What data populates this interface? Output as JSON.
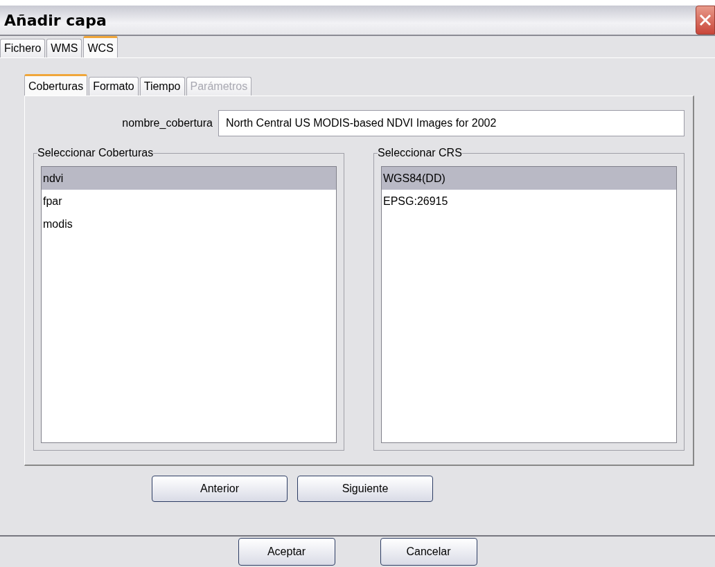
{
  "window": {
    "title": "Añadir capa"
  },
  "tabs": [
    {
      "label": "Fichero",
      "selected": false
    },
    {
      "label": "WMS",
      "selected": false
    },
    {
      "label": "WCS",
      "selected": true
    }
  ],
  "subtabs": [
    {
      "label": "Coberturas",
      "selected": true,
      "disabled": false
    },
    {
      "label": "Formato",
      "selected": false,
      "disabled": false
    },
    {
      "label": "Tiempo",
      "selected": false,
      "disabled": false
    },
    {
      "label": "Parámetros",
      "selected": false,
      "disabled": true
    }
  ],
  "coverage_name": {
    "label": "nombre_cobertura",
    "value": "North Central US MODIS-based NDVI Images for 2002"
  },
  "coverages": {
    "title": "Seleccionar Coberturas",
    "items": [
      {
        "label": "ndvi",
        "selected": true
      },
      {
        "label": "fpar",
        "selected": false
      },
      {
        "label": "modis",
        "selected": false
      }
    ]
  },
  "crs": {
    "title": "Seleccionar CRS",
    "items": [
      {
        "label": "WGS84(DD)",
        "selected": true
      },
      {
        "label": "EPSG:26915",
        "selected": false
      }
    ]
  },
  "nav_buttons": [
    "Anterior",
    "Siguiente"
  ],
  "buttons": [
    "Aceptar",
    "Cancelar"
  ]
}
